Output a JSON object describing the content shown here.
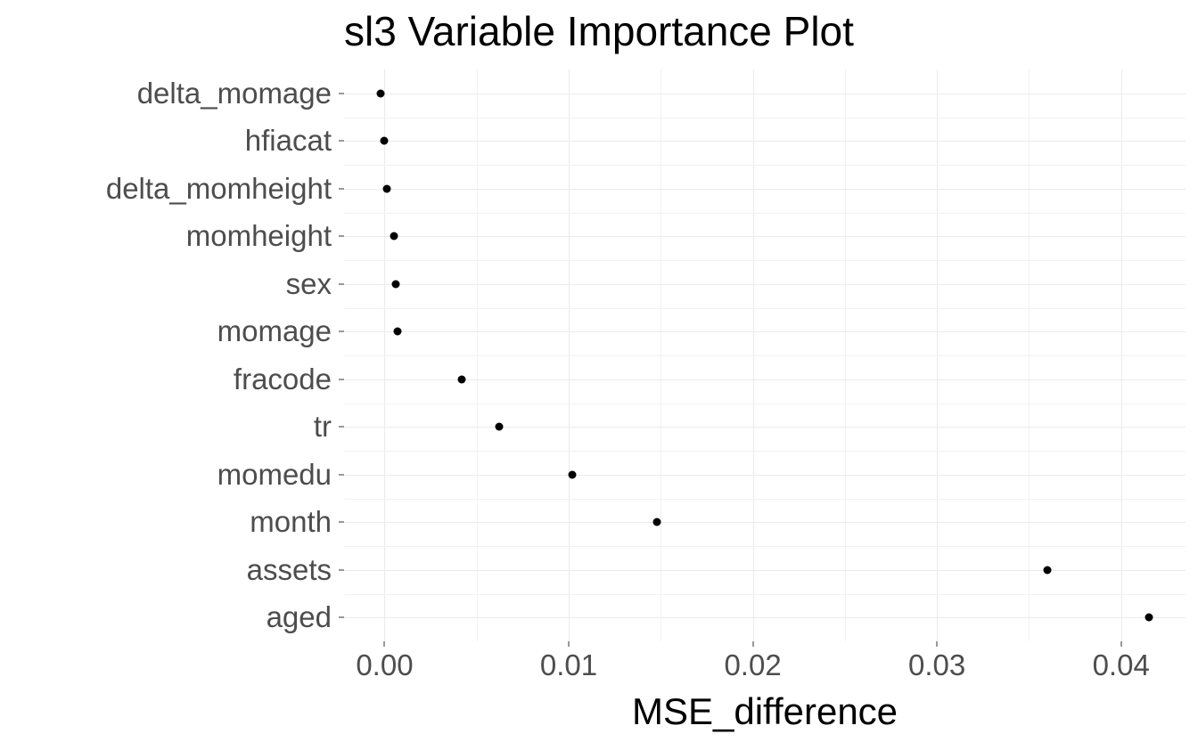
{
  "chart_data": {
    "type": "scatter",
    "title": "sl3 Variable Importance Plot",
    "xlabel": "MSE_difference",
    "ylabel": "",
    "categories_y": [
      "delta_momage",
      "hfiacat",
      "delta_momheight",
      "momheight",
      "sex",
      "momage",
      "fracode",
      "tr",
      "momedu",
      "month",
      "assets",
      "aged"
    ],
    "values_x": [
      -0.0002,
      0.0,
      0.0001,
      0.0005,
      0.0006,
      0.0007,
      0.0042,
      0.0062,
      0.0102,
      0.0148,
      0.036,
      0.0415
    ],
    "x_ticks": [
      0.0,
      0.01,
      0.02,
      0.03,
      0.04
    ],
    "x_tick_labels": [
      "0.00",
      "0.01",
      "0.02",
      "0.03",
      "0.04"
    ],
    "xlim": [
      -0.0022,
      0.0435
    ]
  }
}
